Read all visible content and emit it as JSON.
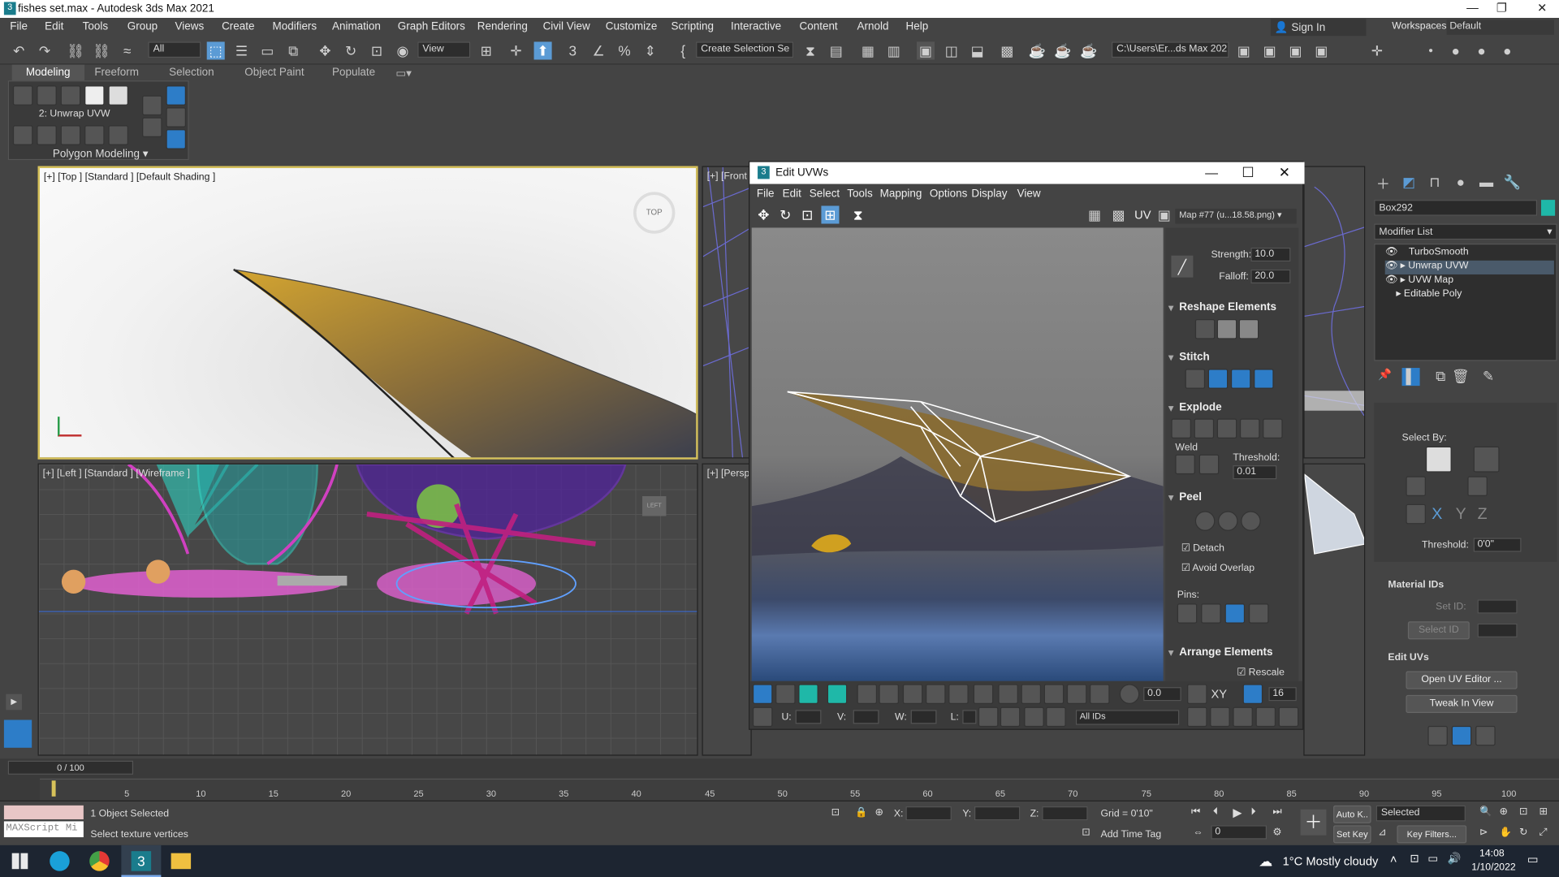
{
  "window": {
    "icon": "3",
    "title": "fishes set.max - Autodesk 3ds Max 2021",
    "minimize": "—",
    "maximize": "❐",
    "close": "✕"
  },
  "menu": [
    "File",
    "Edit",
    "Tools",
    "Group",
    "Views",
    "Create",
    "Modifiers",
    "Animation",
    "Graph Editors",
    "Rendering",
    "Civil View",
    "Customize",
    "Scripting",
    "Interactive",
    "Content",
    "Arnold",
    "Help"
  ],
  "signin": {
    "label": "Sign In",
    "workspaces_label": "Workspaces:",
    "workspace": "Default"
  },
  "toolbar": {
    "filter": "All",
    "view": "View",
    "selection_set": "Create Selection Se",
    "path": "C:\\Users\\Er...ds Max 202"
  },
  "ribbon": {
    "tabs": [
      "Modeling",
      "Freeform",
      "Selection",
      "Object Paint",
      "Populate"
    ],
    "stack": "2: Unwrap UVW",
    "group": "Polygon Modeling"
  },
  "viewports": {
    "top": "[+] [Top ] [Standard ] [Default Shading ]",
    "top_cube": "TOP",
    "left": "[+] [Left ] [Standard ] [Wireframe ]",
    "front": "[+] [Front",
    "persp": "[+] [Persp",
    "left_cube": "LEFT"
  },
  "uvw": {
    "icon": "3",
    "title": "Edit UVWs",
    "menus": [
      "File",
      "Edit",
      "Select",
      "Tools",
      "Mapping",
      "Options",
      "Display",
      "View"
    ],
    "uv_label": "UV",
    "map": "Map #77 (u...18.58.png)",
    "strength_label": "Strength:",
    "strength": "10.0",
    "falloff_label": "Falloff:",
    "falloff": "20.0",
    "sec_reshape": "Reshape Elements",
    "sec_stitch": "Stitch",
    "sec_explode": "Explode",
    "weld": "Weld",
    "threshold_label": "Threshold:",
    "threshold": "0.01",
    "sec_peel": "Peel",
    "detach": "Detach",
    "avoid_overlap": "Avoid Overlap",
    "pins": "Pins:",
    "sec_arrange": "Arrange Elements",
    "rescale": "Rescale",
    "bottom_val": "0.0",
    "xy": "XY",
    "grid_val": "16",
    "u": "U:",
    "v": "V:",
    "w": "W:",
    "l": "L:",
    "ids": "All IDs"
  },
  "cmd": {
    "object": "Box292",
    "modifier_list": "Modifier List",
    "modifiers": [
      "TurboSmooth",
      "Unwrap UVW",
      "UVW Map",
      "Editable Poly"
    ],
    "select_by": "Select By:",
    "threshold_label": "Threshold:",
    "threshold": "0'0\"",
    "material_ids": "Material IDs",
    "set_id": "Set ID:",
    "select_id": "Select ID",
    "edit_uvs": "Edit UVs",
    "open_uv": "Open UV Editor ...",
    "tweak": "Tweak In View"
  },
  "timeline": {
    "frame": "0 / 100",
    "ticks": [
      "5",
      "10",
      "15",
      "20",
      "25",
      "30",
      "35",
      "40",
      "45",
      "50",
      "55",
      "60",
      "65",
      "70",
      "75",
      "80",
      "85",
      "90",
      "95",
      "100"
    ]
  },
  "status": {
    "maxscript": "MAXScript Mi",
    "selected": "1 Object Selected",
    "prompt": "Select texture vertices",
    "x": "X:",
    "y": "Y:",
    "z": "Z:",
    "grid": "Grid = 0'10\"",
    "add_time_tag": "Add Time Tag",
    "auto_key": "Auto K..",
    "selected_dd": "Selected",
    "set_key": "Set Key",
    "key_filters": "Key Filters...",
    "frame_val": "0"
  },
  "taskbar": {
    "weather": "1°C  Mostly cloudy",
    "time": "14:08",
    "date": "1/10/2022"
  },
  "colors": {
    "accent": "#5b9bd5",
    "active": "#2d7dc8",
    "teal": "#1fb8a8"
  }
}
